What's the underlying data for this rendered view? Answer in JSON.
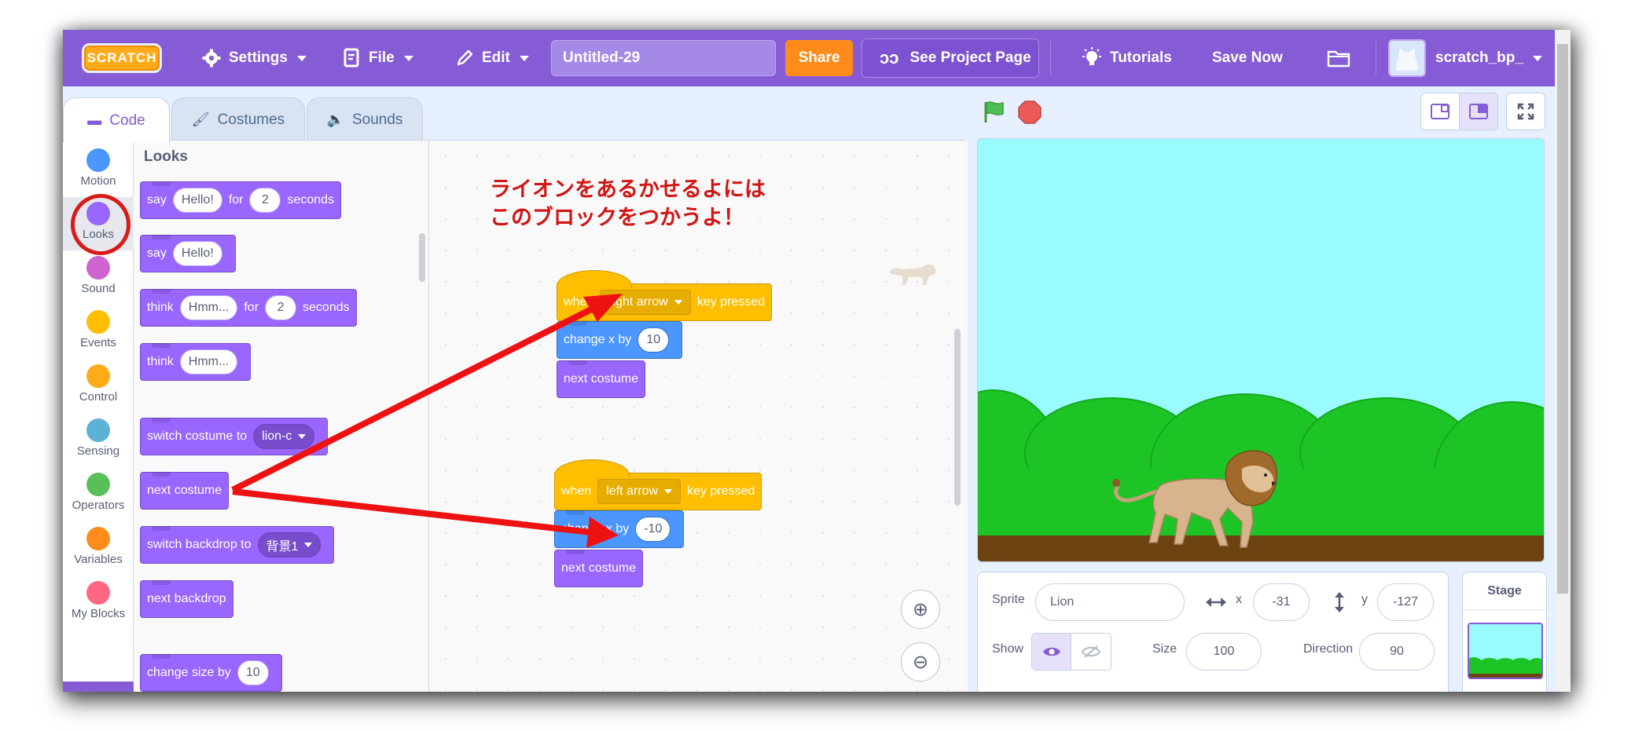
{
  "menu": {
    "logo": "SCRATCH",
    "settings": "Settings",
    "file": "File",
    "edit": "Edit",
    "project_title": "Untitled-29",
    "share": "Share",
    "see_project": "See Project Page",
    "tutorials": "Tutorials",
    "save_now": "Save Now",
    "username": "scratch_bp_"
  },
  "tabs": [
    "Code",
    "Costumes",
    "Sounds"
  ],
  "categories": [
    {
      "label": "Motion",
      "color": "#4c97ff"
    },
    {
      "label": "Looks",
      "color": "#9966ff"
    },
    {
      "label": "Sound",
      "color": "#cf63cf"
    },
    {
      "label": "Events",
      "color": "#ffbf00"
    },
    {
      "label": "Control",
      "color": "#ffab19"
    },
    {
      "label": "Sensing",
      "color": "#5cb1d6"
    },
    {
      "label": "Operators",
      "color": "#59c059"
    },
    {
      "label": "Variables",
      "color": "#ff8c1a"
    },
    {
      "label": "My Blocks",
      "color": "#ff6680"
    }
  ],
  "palette": {
    "title": "Looks",
    "say_for": {
      "a": "say",
      "msg": "Hello!",
      "b": "for",
      "secs": "2",
      "c": "seconds"
    },
    "say": {
      "a": "say",
      "msg": "Hello!"
    },
    "think_for": {
      "a": "think",
      "msg": "Hmm...",
      "b": "for",
      "secs": "2",
      "c": "seconds"
    },
    "think": {
      "a": "think",
      "msg": "Hmm..."
    },
    "switch_costume": {
      "a": "switch costume to",
      "val": "lion-c"
    },
    "next_costume": "next costume",
    "switch_backdrop": {
      "a": "switch backdrop to",
      "val": "背景1"
    },
    "next_backdrop": "next backdrop",
    "change_size": {
      "a": "change size by",
      "val": "10"
    }
  },
  "annotation": {
    "line1": "ライオンをあるかせるよには",
    "line2": "このブロックをつかうよ！"
  },
  "scripts": [
    {
      "when": "when",
      "key": "right arrow",
      "pressed": "key pressed",
      "change": "change x by",
      "dx": "10",
      "next": "next costume"
    },
    {
      "when": "when",
      "key": "left arrow",
      "pressed": "key pressed",
      "change": "change x by",
      "dx": "-10",
      "next": "next costume"
    }
  ],
  "sprite": {
    "label": "Sprite",
    "name": "Lion",
    "x_label": "x",
    "x": "-31",
    "y_label": "y",
    "y": "-127",
    "show_label": "Show",
    "size_label": "Size",
    "size": "100",
    "direction_label": "Direction",
    "direction": "90"
  },
  "stage_panel": {
    "title": "Stage"
  },
  "colors": {
    "menubar": "#855cd6",
    "looks": "#9966ff",
    "motion": "#4c97ff",
    "events": "#ffbf00",
    "arrow": "#ee1111",
    "share": "#ff8c1a"
  }
}
